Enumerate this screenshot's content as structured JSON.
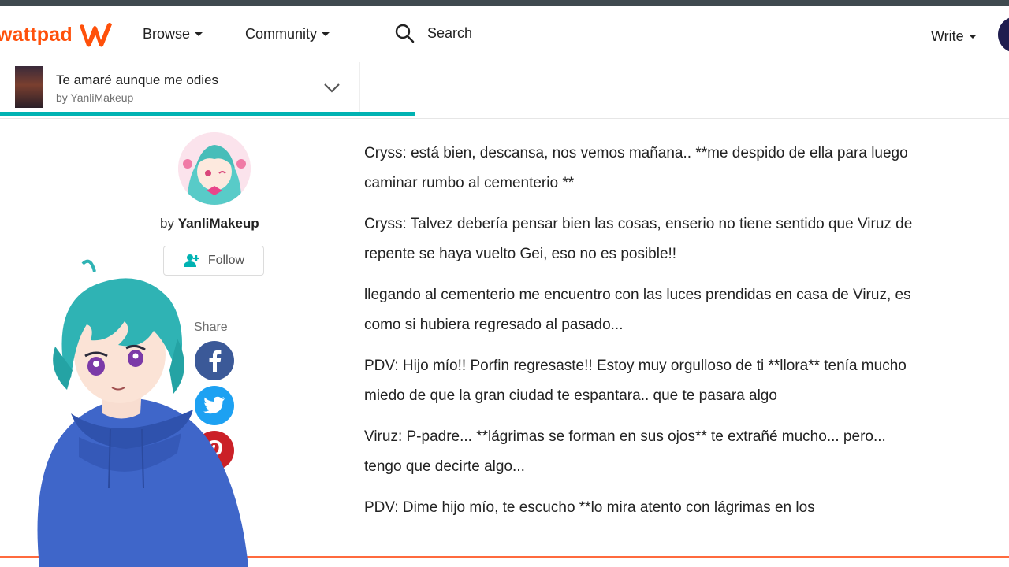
{
  "header": {
    "logo_text": "wattpad",
    "nav": {
      "browse": "Browse",
      "community": "Community",
      "search": "Search",
      "write": "Write"
    }
  },
  "storybar": {
    "title": "Te amaré aunque me odies",
    "author": "by YanliMakeup"
  },
  "sidebar": {
    "by_prefix": "by",
    "author_name": "YanliMakeup",
    "follow_label": "Follow",
    "share_label": "Share"
  },
  "story": {
    "paragraphs": [
      "Cryss: está bien, descansa, nos vemos mañana.. **me despido de ella para luego caminar rumbo al cementerio **",
      "Cryss: Talvez debería pensar bien las cosas, enserio no tiene sentido que Viruz de repente se haya vuelto Gei, eso no es posible!!",
      "llegando al cementerio me encuentro con las luces prendidas en casa de Viruz, es como si hubiera regresado al pasado...",
      "PDV: Hijo mío!! Porfin regresaste!! Estoy muy orgulloso de ti **llora** tenía mucho miedo de que la gran ciudad te espantara.. que te pasara algo",
      "Viruz: P-padre... **lágrimas se forman en sus ojos** te extrañé mucho... pero... tengo que decirte algo...",
      "PDV: Dime hijo mío, te escucho **lo mira atento con lágrimas en los"
    ]
  },
  "colors": {
    "brand": "#ff500a",
    "progress": "#00b2b2",
    "facebook": "#3b5998",
    "twitter": "#1da1f2",
    "pinterest": "#cb2027"
  },
  "icons": [
    "wattpad-w-icon",
    "search-icon",
    "chevron-down-icon",
    "follow-user-icon",
    "facebook-icon",
    "twitter-icon",
    "pinterest-icon"
  ]
}
